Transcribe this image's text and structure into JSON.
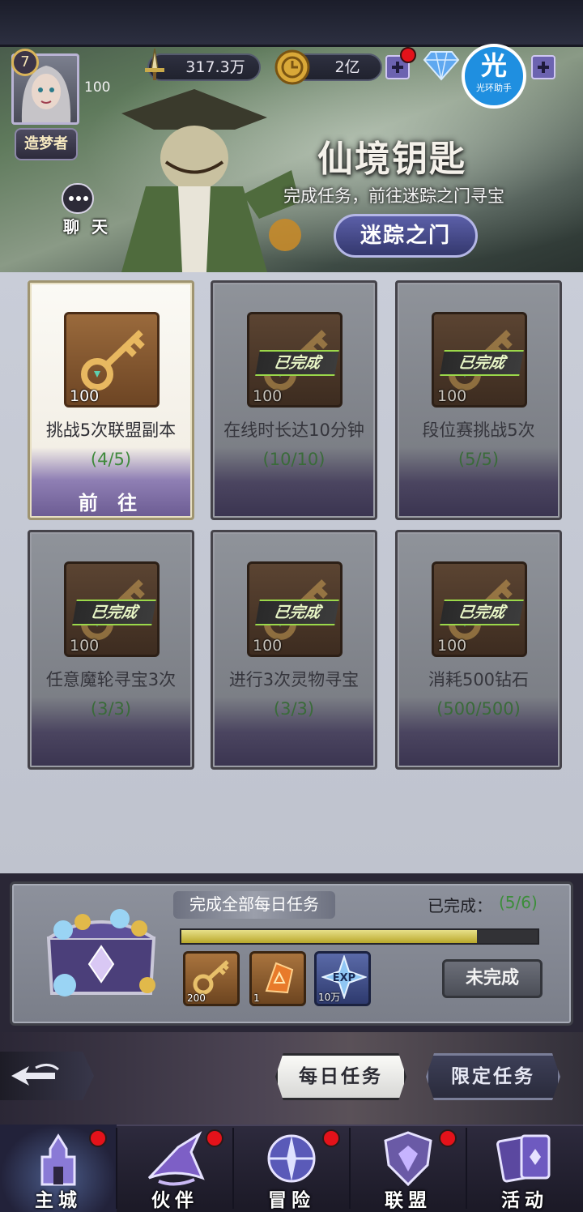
{
  "header": {
    "level": "7",
    "power_small": "100",
    "rank_title": "造梦者",
    "resource_power": "317.3万",
    "resource_gold": "2亿",
    "chat_label": "聊 天",
    "helper_badge_big": "光",
    "helper_badge_small": "光环助手"
  },
  "event": {
    "title": "仙境钥匙",
    "description": "完成任务，前往迷踪之门寻宝",
    "button_label": "迷踪之门"
  },
  "tasks": [
    {
      "name": "挑战5次联盟副本",
      "progress": "(4/5)",
      "qty": "100",
      "status": "active",
      "action_label": "前 往"
    },
    {
      "name": "在线时长达10分钟",
      "progress": "(10/10)",
      "qty": "100",
      "status": "done",
      "stamp": "已完成"
    },
    {
      "name": "段位赛挑战5次",
      "progress": "(5/5)",
      "qty": "100",
      "status": "done",
      "stamp": "已完成"
    },
    {
      "name": "任意魔轮寻宝3次",
      "progress": "(3/3)",
      "qty": "100",
      "status": "done",
      "stamp": "已完成"
    },
    {
      "name": "进行3次灵物寻宝",
      "progress": "(3/3)",
      "qty": "100",
      "status": "done",
      "stamp": "已完成"
    },
    {
      "name": "消耗500钻石",
      "progress": "(500/500)",
      "qty": "100",
      "status": "done",
      "stamp": "已完成"
    }
  ],
  "summary": {
    "title": "完成全部每日任务",
    "status_label": "已完成：",
    "status_count": "(5/6)",
    "progress_fraction": 0.83,
    "rewards": [
      {
        "icon": "key-icon",
        "qty": "200"
      },
      {
        "icon": "rune-stone-icon",
        "qty": "1"
      },
      {
        "icon": "exp-star-icon",
        "qty": "10万"
      }
    ],
    "button_label": "未完成"
  },
  "mode_tabs": {
    "daily": "每日任务",
    "limited": "限定任务"
  },
  "nav": [
    {
      "label": "主城",
      "icon": "castle-icon",
      "badge": true,
      "active": true
    },
    {
      "label": "伙伴",
      "icon": "witch-hat-icon",
      "badge": true,
      "active": false
    },
    {
      "label": "冒险",
      "icon": "compass-orb-icon",
      "badge": true,
      "active": false
    },
    {
      "label": "联盟",
      "icon": "shield-crest-icon",
      "badge": true,
      "active": false
    },
    {
      "label": "活动",
      "icon": "cards-icon",
      "badge": false,
      "active": false
    }
  ],
  "colors": {
    "progress_green": "#3f8a3c",
    "badge_red": "#e4121a",
    "bar_fill": "#d3c84a",
    "helper_blue": "#1f8fe0"
  }
}
